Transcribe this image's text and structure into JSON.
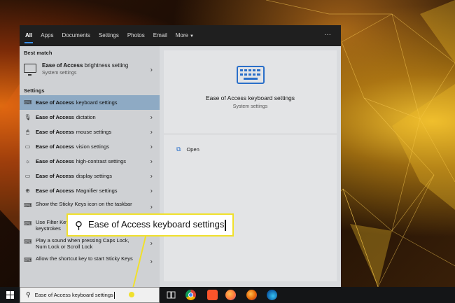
{
  "tabs": [
    {
      "label": "All",
      "active": true
    },
    {
      "label": "Apps"
    },
    {
      "label": "Documents"
    },
    {
      "label": "Settings"
    },
    {
      "label": "Photos"
    },
    {
      "label": "Email"
    },
    {
      "label": "More"
    }
  ],
  "tabs_ellipsis": "···",
  "best_match": {
    "header": "Best match",
    "title_bold": "Ease of Access",
    "title_rest": " brightness setting",
    "subtitle": "System settings"
  },
  "settings_header": "Settings",
  "settings_items": [
    {
      "bold": "Ease of Access",
      "rest": "keyboard settings",
      "icon": "keyboard-icon",
      "selected": true
    },
    {
      "bold": "Ease of Access",
      "rest": "dictation",
      "icon": "microphone-icon"
    },
    {
      "bold": "Ease of Access",
      "rest": "mouse settings",
      "icon": "mouse-icon"
    },
    {
      "bold": "Ease of Access",
      "rest": "vision settings",
      "icon": "monitor-icon"
    },
    {
      "bold": "Ease of Access",
      "rest": "high-contrast settings",
      "icon": "sun-icon"
    },
    {
      "bold": "Ease of Access",
      "rest": "display settings",
      "icon": "monitor-icon"
    },
    {
      "bold": "Ease of Access",
      "rest": "Magnifier settings",
      "icon": "magnifier-icon"
    }
  ],
  "extra_items": [
    {
      "text": "Show the Sticky Keys icon on the taskbar",
      "icon": "keyboard-icon"
    },
    {
      "text": "Use Filter Keys to ignore brief or repeated keystrokes",
      "icon": "keyboard-icon"
    },
    {
      "text": "Play a sound when pressing Caps Lock, Num Lock or Scroll Lock",
      "icon": "keyboard-icon"
    },
    {
      "text": "Allow the shortcut key to start Sticky Keys",
      "icon": "keyboard-icon"
    }
  ],
  "preview": {
    "title": "Ease of Access keyboard settings",
    "subtitle": "System settings",
    "action": "Open"
  },
  "callout_text": "Ease of Access keyboard settings",
  "search_value": "Ease of Access keyboard settings",
  "colors": {
    "accent": "#3a8ee6",
    "highlight": "#f0e02c",
    "selected_row": "#8eaac4"
  }
}
